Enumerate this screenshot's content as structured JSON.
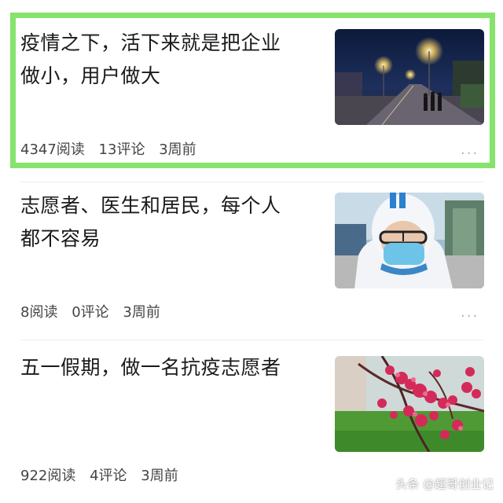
{
  "articles": [
    {
      "title_line1": "疫情之下，活下来就是把企业",
      "title_line2": "做小，用户做大",
      "reads": "4347阅读",
      "comments": "13评论",
      "time": "3周前",
      "more": "···",
      "image": "night-street-photo"
    },
    {
      "title_line1": "志愿者、医生和居民，每个人",
      "title_line2": "都不容易",
      "reads": "8阅读",
      "comments": "0评论",
      "time": "3周前",
      "more": "···",
      "image": "medical-worker-photo"
    },
    {
      "title_line1": "五一假期，做一名抗疫志愿者",
      "reads": "922阅读",
      "comments": "4评论",
      "time": "3周前",
      "image": "pink-blossom-photo"
    }
  ],
  "watermark": "头条 @超哥创业记",
  "colors": {
    "highlight_border": "#86e36b"
  }
}
